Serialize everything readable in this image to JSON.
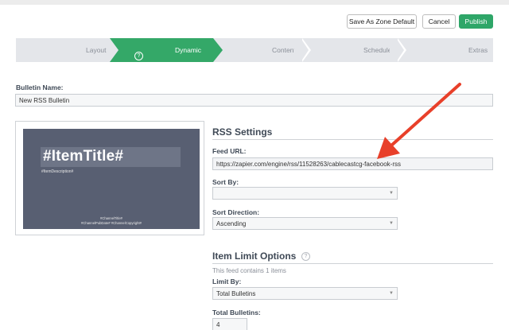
{
  "toolbar": {
    "save_zone_label": "Save As Zone Default",
    "cancel_label": "Cancel",
    "publish_label": "Publish"
  },
  "steps": {
    "layout": "Layout",
    "dynamic": "Dynamic",
    "dynamic_help": "?",
    "content": "Content",
    "schedule": "Schedule",
    "extras": "Extras"
  },
  "bulletin_name": {
    "label": "Bulletin Name:",
    "value": "New RSS Bulletin"
  },
  "preview": {
    "title": "#ItemTitle#",
    "description": "#ItemDescription#",
    "footer_line1": "#ChannelTitle#",
    "footer_line2": "#ChannelPubDate# #ChannelCopyright#"
  },
  "rss_settings": {
    "heading": "RSS Settings",
    "feed_url_label": "Feed URL:",
    "feed_url_value": "https://zapier.com/engine/rss/11528263/cablecastcg-facebook-rss",
    "sort_by_label": "Sort By:",
    "sort_by_value": "",
    "sort_direction_label": "Sort Direction:",
    "sort_direction_value": "Ascending"
  },
  "item_limit": {
    "heading": "Item Limit Options",
    "help": "?",
    "note": "This feed contains 1 items",
    "limit_by_label": "Limit By:",
    "limit_by_value": "Total Bulletins",
    "total_bulletins_label": "Total Bulletins:",
    "total_bulletins_value": "4"
  },
  "colors": {
    "accent_green": "#34a868",
    "annotation_red": "#e8402a"
  }
}
